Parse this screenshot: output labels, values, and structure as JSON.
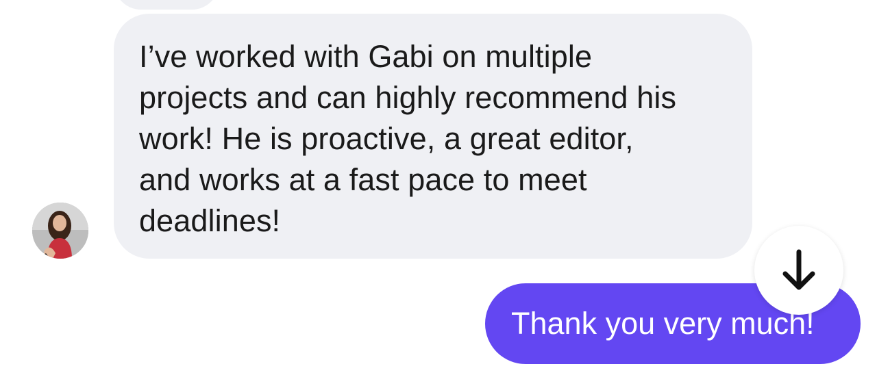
{
  "conversation": {
    "incoming_message": {
      "text": "I’ve worked with Gabi on multiple\nprojects and can highly recommend his\nwork! He is proactive, a great editor,\nand works at a fast pace to meet\ndeadlines!",
      "bubble_color": "#eff0f4",
      "avatar_icon": "user-avatar-photo"
    },
    "outgoing_message": {
      "text": "Thank you very much!",
      "bubble_color": "#6347f2",
      "text_color": "#ffffff"
    },
    "scroll_button": {
      "icon": "arrow-down-icon"
    }
  }
}
